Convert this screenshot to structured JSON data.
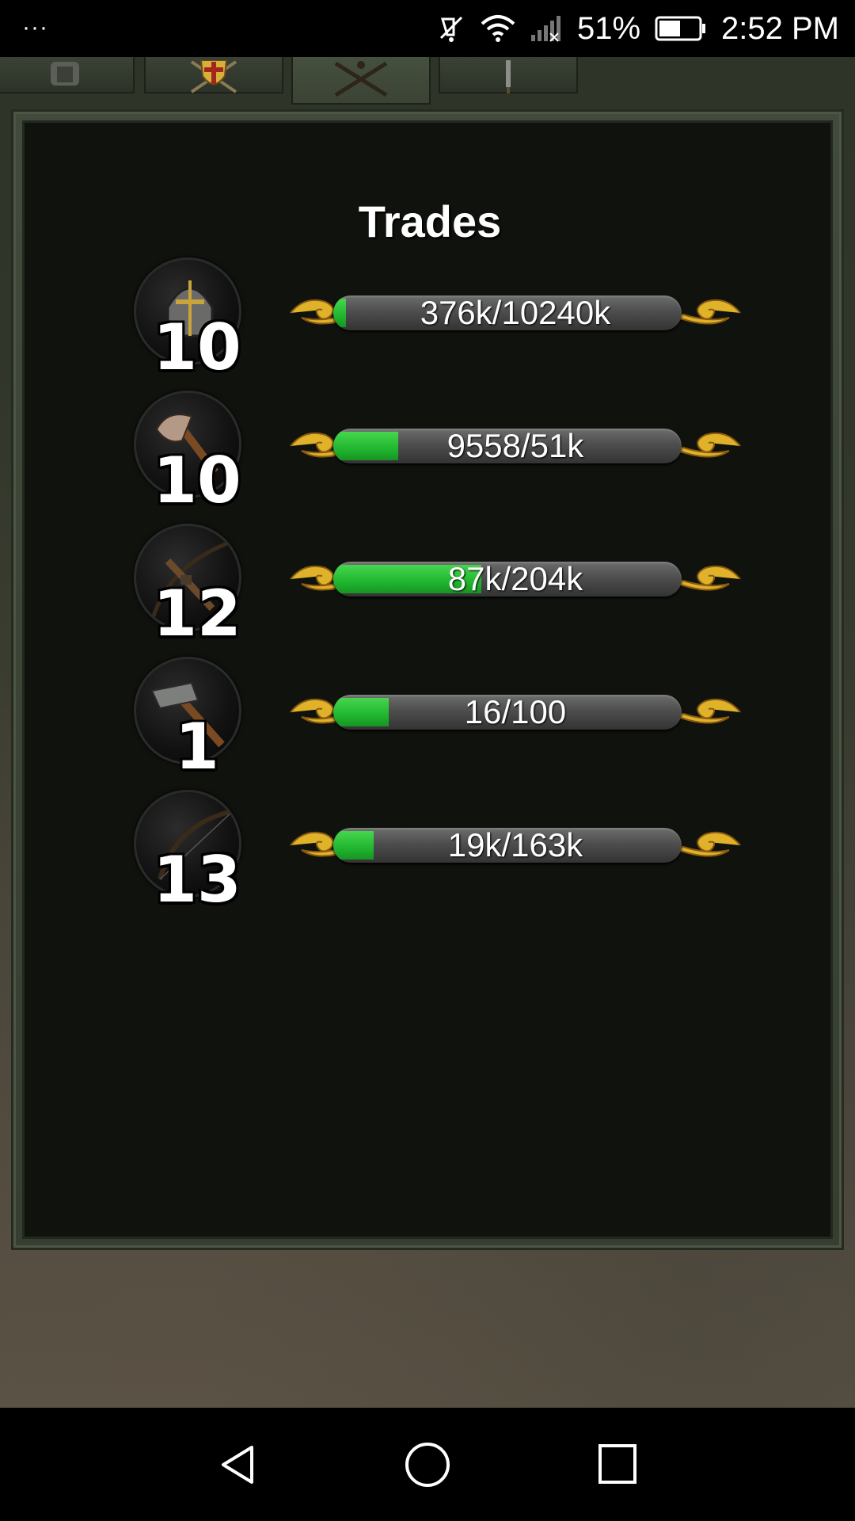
{
  "status_bar": {
    "menu_dots": "···",
    "battery_percent": "51%",
    "time": "2:52 PM",
    "icons": [
      "mute-icon",
      "wifi-icon",
      "signal-icon",
      "battery-icon"
    ]
  },
  "tabs": [
    {
      "name": "tab-armor",
      "icon": "armor-icon",
      "active": false
    },
    {
      "name": "tab-shield",
      "icon": "shield-icon",
      "active": false
    },
    {
      "name": "tab-trades",
      "icon": "crossed-tools-icon",
      "active": true
    },
    {
      "name": "tab-sword",
      "icon": "sword-icon",
      "active": false
    }
  ],
  "panel": {
    "title": "Trades",
    "trades": [
      {
        "icon": "helmet-icon",
        "level": "10",
        "progress_text": "376k/10240k",
        "progress_fraction": 0.037
      },
      {
        "icon": "axe-icon",
        "level": "10",
        "progress_text": "9558/51k",
        "progress_fraction": 0.187
      },
      {
        "icon": "crossbow-icon",
        "level": "12",
        "progress_text": "87k/204k",
        "progress_fraction": 0.426
      },
      {
        "icon": "hammer-icon",
        "level": "1",
        "progress_text": "16/100",
        "progress_fraction": 0.16
      },
      {
        "icon": "bow-icon",
        "level": "13",
        "progress_text": "19k/163k",
        "progress_fraction": 0.117
      }
    ]
  },
  "colors": {
    "panel_bg": "#10130d",
    "progress_fill": "#21b630",
    "ornament_gold": "#e0b22a"
  },
  "nav_bar": {
    "icons": [
      "back-icon",
      "home-icon",
      "recents-icon"
    ]
  }
}
